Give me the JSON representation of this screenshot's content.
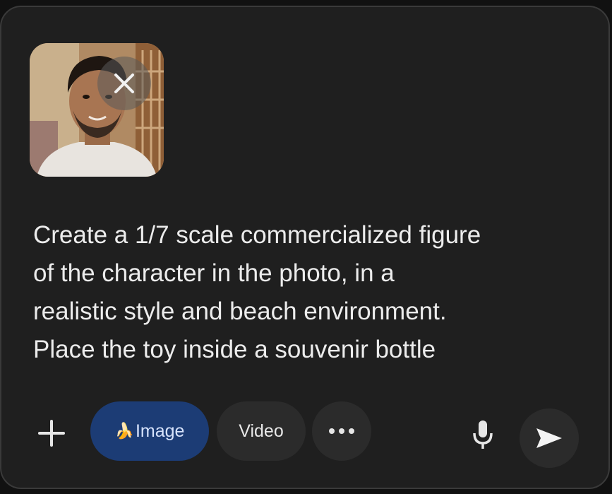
{
  "composer": {
    "attachment": {
      "alt": "attached photo",
      "remove_icon": "close-icon"
    },
    "prompt_text": "Create a 1/7 scale commercialized figure\nof the character in the photo, in a\nrealistic style and beach environment.\nPlace the toy inside a souvenir bottle",
    "toolbar": {
      "add_icon": "plus-icon",
      "image_label": "Image",
      "image_emoji": "🍌",
      "video_label": "Video",
      "more_icon": "more-horizontal-icon",
      "mic_icon": "microphone-icon",
      "send_icon": "send-icon"
    }
  },
  "colors": {
    "background": "#1f1f1f",
    "image_pill": "#1c3c75",
    "pill": "#2b2b2b",
    "text": "#ececec"
  }
}
